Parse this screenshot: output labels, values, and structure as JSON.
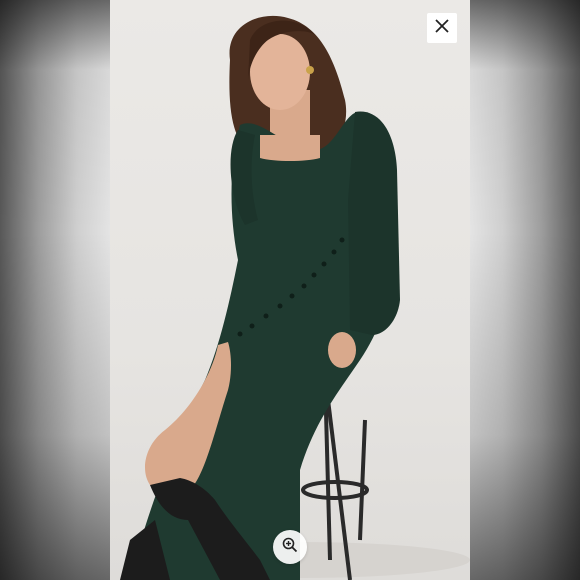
{
  "viewer": {
    "image_alt": "",
    "close_icon": "close-icon",
    "zoom_icon": "zoom-in-icon"
  },
  "colors": {
    "dress": "#1f3a30",
    "backdrop": "#e8e6e3",
    "boot": "#1c1c1c",
    "hair": "#4a2e1f",
    "skin": "#d9a98c"
  }
}
